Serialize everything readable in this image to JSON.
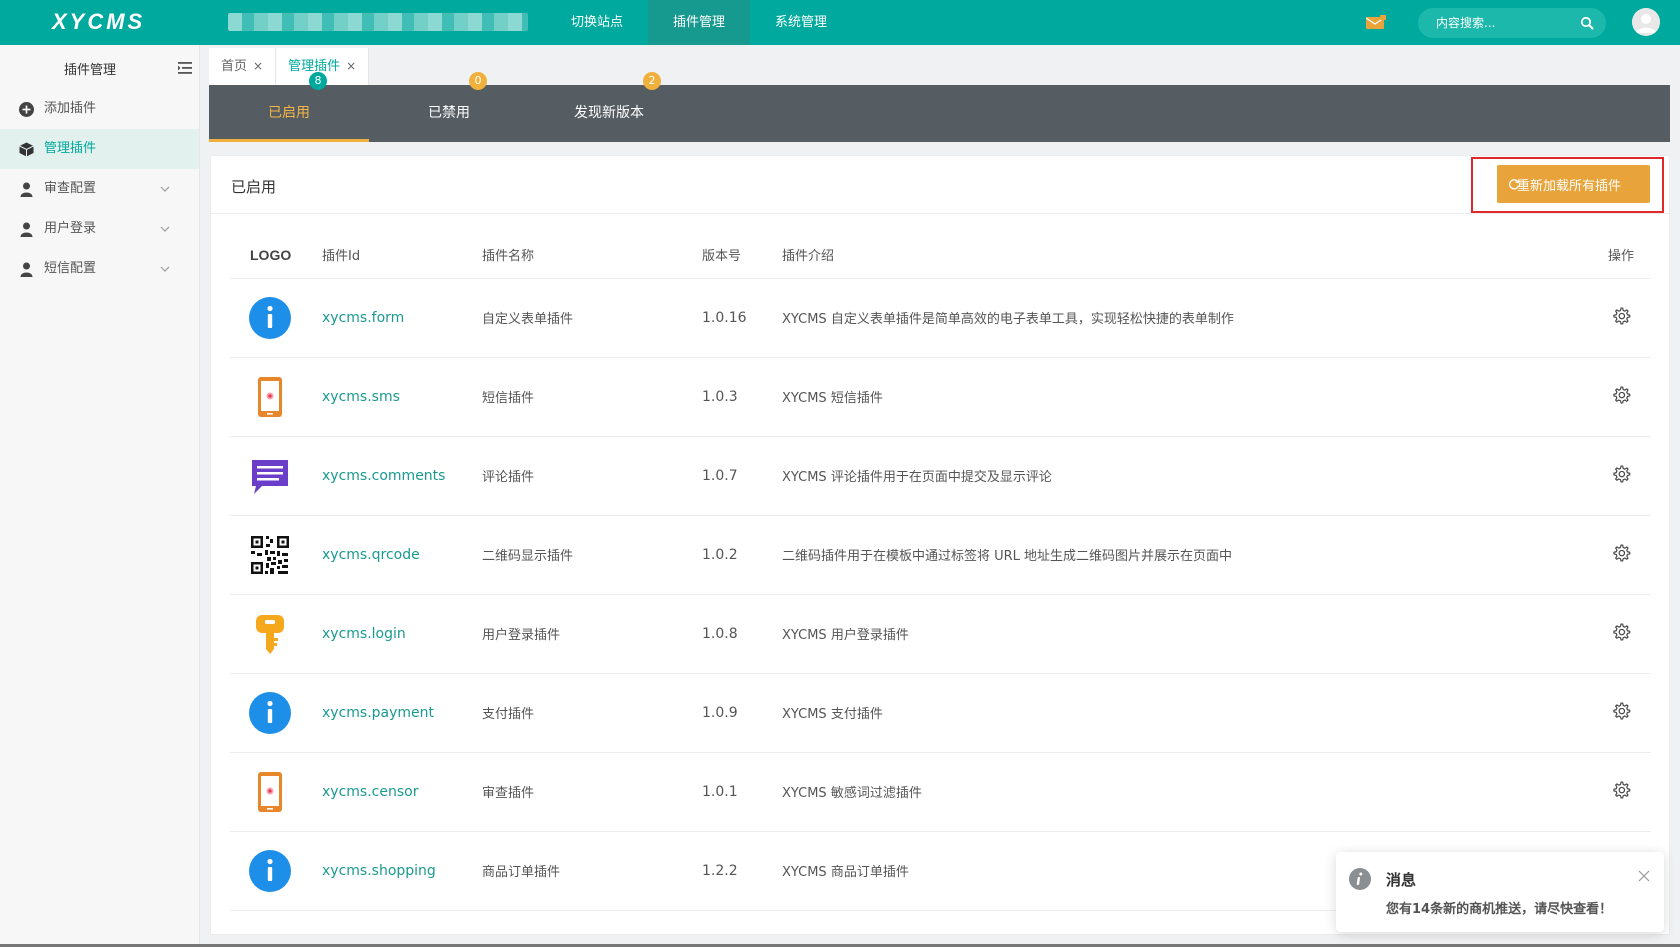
{
  "brand": {
    "logo_text": "XYCMS"
  },
  "topnav": {
    "items": [
      "切换站点",
      "插件管理",
      "系统管理"
    ],
    "active_index": 1
  },
  "search": {
    "placeholder": "内容搜索..."
  },
  "sidebar": {
    "title": "插件管理",
    "items": [
      {
        "label": "添加插件",
        "icon": "plus-circle-icon"
      },
      {
        "label": "管理插件",
        "icon": "cube-icon",
        "active": true
      },
      {
        "label": "审查配置",
        "icon": "user-icon",
        "expandable": true
      },
      {
        "label": "用户登录",
        "icon": "user-icon",
        "expandable": true
      },
      {
        "label": "短信配置",
        "icon": "user-icon",
        "expandable": true
      }
    ]
  },
  "tabs": [
    {
      "label": "首页",
      "close": "×"
    },
    {
      "label": "管理插件",
      "close": "×",
      "active": true
    }
  ],
  "subtabs": [
    {
      "label": "已启用",
      "badge": "8",
      "active": true
    },
    {
      "label": "已禁用",
      "badge": "0"
    },
    {
      "label": "发现新版本",
      "badge": "2"
    }
  ],
  "panel": {
    "title": "已启用",
    "reload_label": "重新加载所有插件"
  },
  "table": {
    "headers": [
      "LOGO",
      "插件Id",
      "插件名称",
      "版本号",
      "插件介绍",
      "操作"
    ],
    "rows": [
      {
        "logo": "info-icon",
        "id": "xycms.form",
        "name": "自定义表单插件",
        "version": "1.0.16",
        "desc": "XYCMS 自定义表单插件是简单高效的电子表单工具，实现轻松快捷的表单制作"
      },
      {
        "logo": "phone-icon",
        "id": "xycms.sms",
        "name": "短信插件",
        "version": "1.0.3",
        "desc": "XYCMS 短信插件"
      },
      {
        "logo": "comment-icon",
        "id": "xycms.comments",
        "name": "评论插件",
        "version": "1.0.7",
        "desc": "XYCMS 评论插件用于在页面中提交及显示评论"
      },
      {
        "logo": "qrcode-icon",
        "id": "xycms.qrcode",
        "name": "二维码显示插件",
        "version": "1.0.2",
        "desc": "二维码插件用于在模板中通过标签将 URL 地址生成二维码图片并展示在页面中"
      },
      {
        "logo": "key-icon",
        "id": "xycms.login",
        "name": "用户登录插件",
        "version": "1.0.8",
        "desc": "XYCMS 用户登录插件"
      },
      {
        "logo": "info-icon",
        "id": "xycms.payment",
        "name": "支付插件",
        "version": "1.0.9",
        "desc": "XYCMS 支付插件"
      },
      {
        "logo": "phone-icon",
        "id": "xycms.censor",
        "name": "审查插件",
        "version": "1.0.1",
        "desc": "XYCMS 敏感词过滤插件"
      },
      {
        "logo": "info-icon",
        "id": "xycms.shopping",
        "name": "商品订单插件",
        "version": "1.2.2",
        "desc": "XYCMS 商品订单插件"
      }
    ]
  },
  "notification": {
    "title": "消息",
    "message": "您有14条新的商机推送，请尽快查看！"
  },
  "colors": {
    "primary": "#00a99d",
    "accent": "#e8a43a",
    "subtab_bg": "#555d63",
    "highlight": "#e02a2a"
  }
}
